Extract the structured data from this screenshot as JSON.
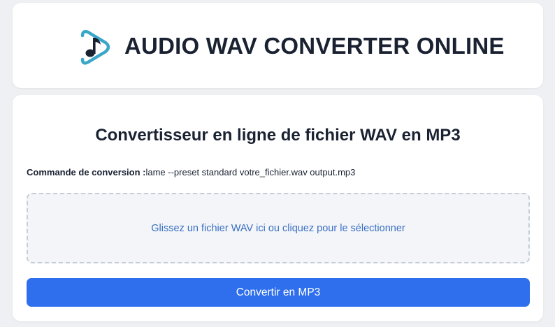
{
  "header": {
    "title": "AUDIO WAV CONVERTER ONLINE",
    "logo_icon": "music-note-play-icon"
  },
  "converter": {
    "title": "Convertisseur en ligne de fichier WAV en MP3",
    "command_label": "Commande de conversion :",
    "command_value": "lame --preset standard votre_fichier.wav output.mp3",
    "drop_zone_text": "Glissez un fichier WAV ici ou cliquez pour le sélectionner",
    "convert_button_label": "Convertir en MP3"
  },
  "colors": {
    "accent": "#2f6fed",
    "logo_teal": "#3aa7c8",
    "drop_text": "#3a6fc4",
    "title_text": "#1a2232"
  }
}
